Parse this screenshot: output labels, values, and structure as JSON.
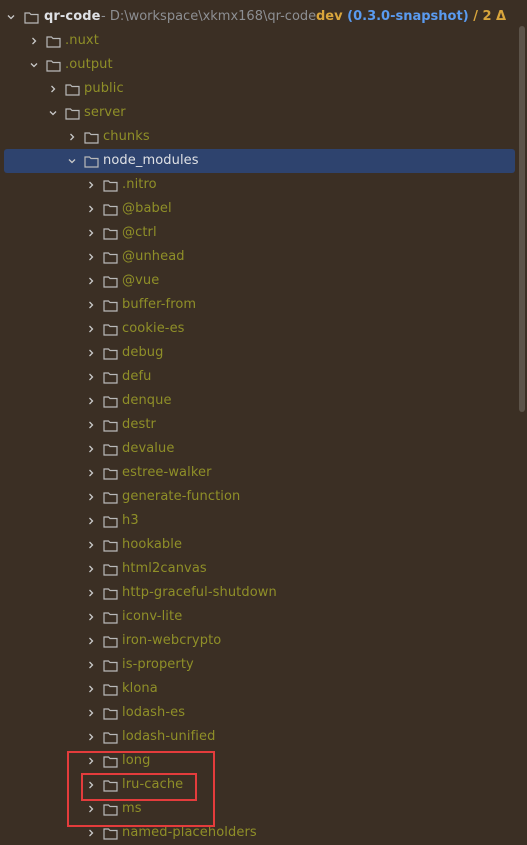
{
  "root": {
    "name": "qr-code",
    "path": "- D:\\workspace\\xkmx168\\qr-code",
    "branch": "dev",
    "version": "(0.3.0-snapshot)",
    "separator": "/",
    "changes": "2 Δ"
  },
  "tree": [
    {
      "label": ".nuxt",
      "depth": 1,
      "expanded": false
    },
    {
      "label": ".output",
      "depth": 1,
      "expanded": true
    },
    {
      "label": "public",
      "depth": 2,
      "expanded": false
    },
    {
      "label": "server",
      "depth": 2,
      "expanded": true
    },
    {
      "label": "chunks",
      "depth": 3,
      "expanded": false
    },
    {
      "label": "node_modules",
      "depth": 3,
      "expanded": true,
      "selected": true
    },
    {
      "label": ".nitro",
      "depth": 4,
      "expanded": false
    },
    {
      "label": "@babel",
      "depth": 4,
      "expanded": false
    },
    {
      "label": "@ctrl",
      "depth": 4,
      "expanded": false
    },
    {
      "label": "@unhead",
      "depth": 4,
      "expanded": false
    },
    {
      "label": "@vue",
      "depth": 4,
      "expanded": false
    },
    {
      "label": "buffer-from",
      "depth": 4,
      "expanded": false
    },
    {
      "label": "cookie-es",
      "depth": 4,
      "expanded": false
    },
    {
      "label": "debug",
      "depth": 4,
      "expanded": false
    },
    {
      "label": "defu",
      "depth": 4,
      "expanded": false
    },
    {
      "label": "denque",
      "depth": 4,
      "expanded": false
    },
    {
      "label": "destr",
      "depth": 4,
      "expanded": false
    },
    {
      "label": "devalue",
      "depth": 4,
      "expanded": false
    },
    {
      "label": "estree-walker",
      "depth": 4,
      "expanded": false
    },
    {
      "label": "generate-function",
      "depth": 4,
      "expanded": false
    },
    {
      "label": "h3",
      "depth": 4,
      "expanded": false
    },
    {
      "label": "hookable",
      "depth": 4,
      "expanded": false
    },
    {
      "label": "html2canvas",
      "depth": 4,
      "expanded": false
    },
    {
      "label": "http-graceful-shutdown",
      "depth": 4,
      "expanded": false
    },
    {
      "label": "iconv-lite",
      "depth": 4,
      "expanded": false
    },
    {
      "label": "iron-webcrypto",
      "depth": 4,
      "expanded": false
    },
    {
      "label": "is-property",
      "depth": 4,
      "expanded": false
    },
    {
      "label": "klona",
      "depth": 4,
      "expanded": false
    },
    {
      "label": "lodash-es",
      "depth": 4,
      "expanded": false
    },
    {
      "label": "lodash-unified",
      "depth": 4,
      "expanded": false
    },
    {
      "label": "long",
      "depth": 4,
      "expanded": false
    },
    {
      "label": "lru-cache",
      "depth": 4,
      "expanded": false
    },
    {
      "label": "ms",
      "depth": 4,
      "expanded": false
    },
    {
      "label": "named-placeholders",
      "depth": 4,
      "expanded": false
    }
  ],
  "colors": {
    "background": "#3b2f24",
    "selection": "#2e436e",
    "folder_label": "#8f8f28",
    "folder_icon": "#b9b9b9",
    "highlight": "#e43c3c"
  }
}
